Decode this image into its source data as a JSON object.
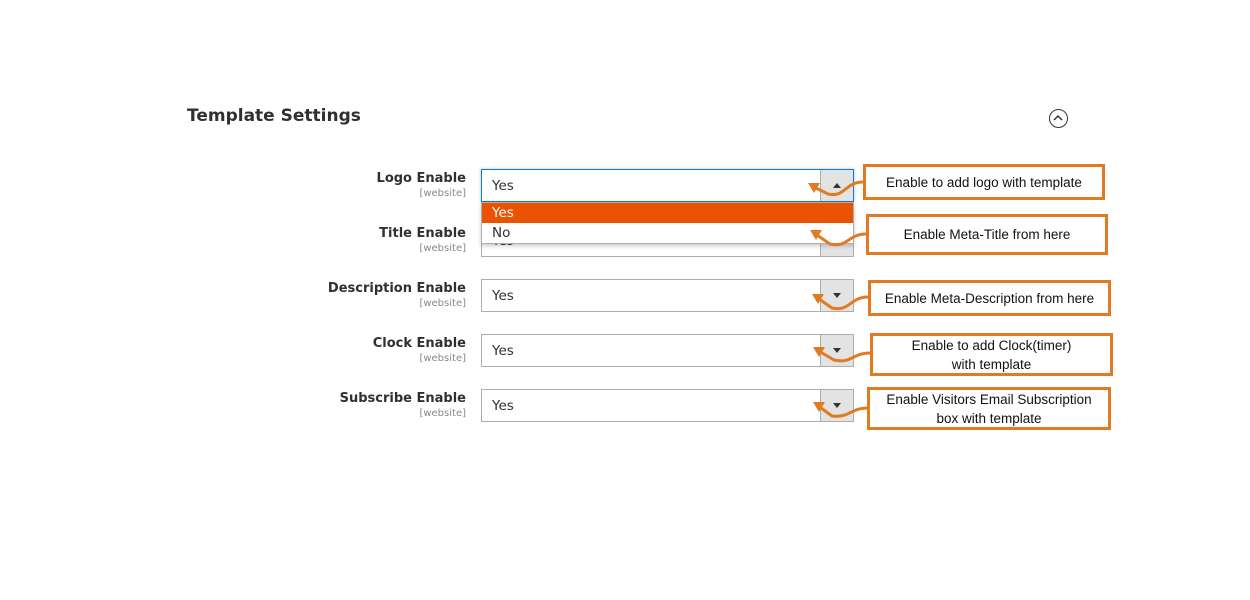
{
  "section": {
    "title": "Template Settings",
    "collapse_icon": "chevron-up-circle-icon"
  },
  "fields": [
    {
      "label": "Logo Enable",
      "scope": "[website]",
      "value": "Yes",
      "open": true
    },
    {
      "label": "Title Enable",
      "scope": "[website]",
      "value": "Yes"
    },
    {
      "label": "Description Enable",
      "scope": "[website]",
      "value": "Yes"
    },
    {
      "label": "Clock Enable",
      "scope": "[website]",
      "value": "Yes"
    },
    {
      "label": "Subscribe Enable",
      "scope": "[website]",
      "value": "Yes"
    }
  ],
  "dropdown": {
    "options": [
      "Yes",
      "No"
    ],
    "highlighted": "Yes",
    "highlight_color": "#eb5202"
  },
  "callouts": [
    {
      "line1": "Enable to add logo with template"
    },
    {
      "line1": "Enable Meta-Title from here"
    },
    {
      "line1": "Enable Meta-Description from here"
    },
    {
      "line1": "Enable to add Clock(timer)",
      "line2": "with template"
    },
    {
      "line1": "Enable Visitors Email Subscription",
      "line2": "box with template"
    }
  ],
  "annotation_color": "#e07b22"
}
